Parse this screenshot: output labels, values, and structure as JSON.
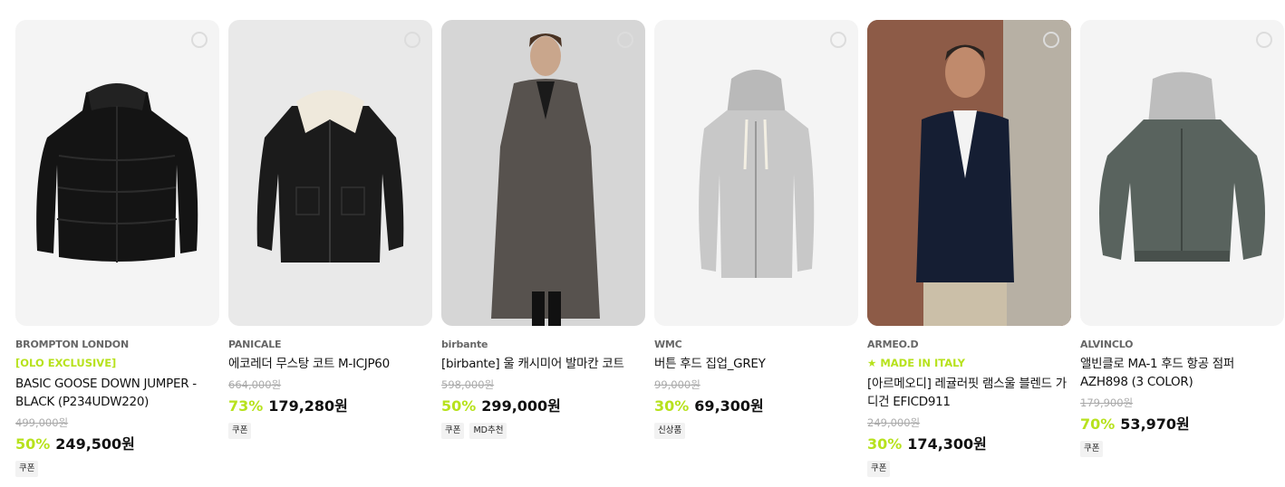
{
  "products": [
    {
      "brand": "BROMPTON LONDON",
      "tag": "[OLO EXCLUSIVE]",
      "name": "BASIC GOOSE DOWN JUMPER - BLACK (P234UDW220)",
      "original_price": "499,000원",
      "discount_rate": "50%",
      "price": "249,500원",
      "badges": [
        "쿠폰"
      ],
      "image": "black-puffer-jacket"
    },
    {
      "brand": "PANICALE",
      "tag": "",
      "name": "에코레더 무스탕 코트 M-ICJP60",
      "original_price": "664,000원",
      "discount_rate": "73%",
      "price": "179,280원",
      "badges": [
        "쿠폰"
      ],
      "image": "black-leather-shearling-coat"
    },
    {
      "brand": "birbante",
      "tag": "",
      "name": "[birbante] 울 캐시미어 발마칸 코트",
      "original_price": "598,000원",
      "discount_rate": "50%",
      "price": "299,000원",
      "badges": [
        "쿠폰",
        "MD추천"
      ],
      "image": "model-grey-long-coat"
    },
    {
      "brand": "WMC",
      "tag": "",
      "name": "버튼 후드 집업_GREY",
      "original_price": "99,000원",
      "discount_rate": "30%",
      "price": "69,300원",
      "badges": [
        "신상품"
      ],
      "image": "grey-zip-hoodie"
    },
    {
      "brand": "ARMEO.D",
      "tag": "★ MADE IN ITALY",
      "name": "[아르메오디] 레귤러핏 램스울 블렌드 가디건 EFICD911",
      "original_price": "249,000원",
      "discount_rate": "30%",
      "price": "174,300원",
      "badges": [
        "쿠폰"
      ],
      "image": "model-navy-cardigan"
    },
    {
      "brand": "ALVINCLO",
      "tag": "",
      "name": "앨빈클로 MA-1 후드 항공 점퍼 AZH898 (3 COLOR)",
      "original_price": "179,900원",
      "discount_rate": "70%",
      "price": "53,970원",
      "badges": [
        "쿠폰"
      ],
      "image": "khaki-ma1-hooded-bomber"
    }
  ]
}
